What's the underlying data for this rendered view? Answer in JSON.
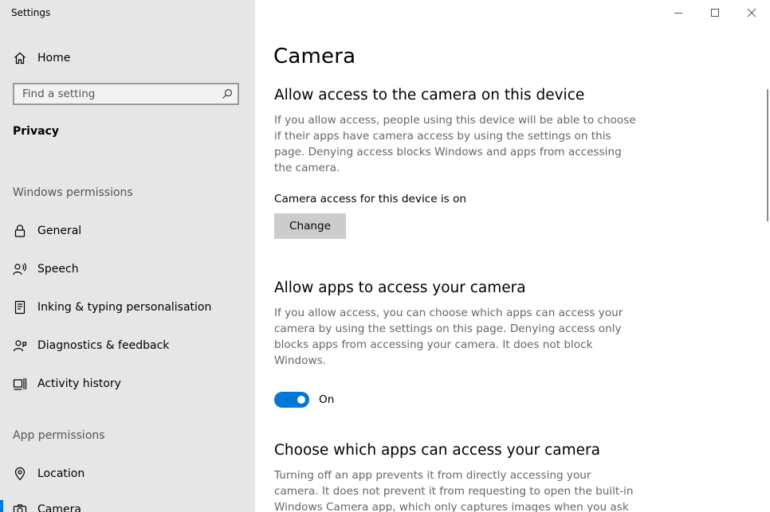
{
  "window": {
    "app_title": "Settings"
  },
  "sidebar": {
    "home": {
      "label": "Home",
      "icon": "home-icon"
    },
    "search": {
      "placeholder": "Find a setting",
      "icon": "search-icon"
    },
    "category": "Privacy",
    "groups": [
      {
        "label": "Windows permissions",
        "items": [
          {
            "label": "General",
            "icon": "lock-icon"
          },
          {
            "label": "Speech",
            "icon": "speech-icon"
          },
          {
            "label": "Inking & typing personalisation",
            "icon": "inking-icon"
          },
          {
            "label": "Diagnostics & feedback",
            "icon": "diagnostics-icon"
          },
          {
            "label": "Activity history",
            "icon": "activity-history-icon"
          }
        ]
      },
      {
        "label": "App permissions",
        "items": [
          {
            "label": "Location",
            "icon": "location-icon"
          },
          {
            "label": "Camera",
            "icon": "camera-icon",
            "selected": true
          }
        ]
      }
    ]
  },
  "main": {
    "title": "Camera",
    "sections": [
      {
        "heading": "Allow access to the camera on this device",
        "text": "If you allow access, people using this device will be able to choose if their apps have camera access by using the settings on this page. Denying access blocks Windows and apps from accessing the camera.",
        "status": "Camera access for this device is on",
        "button_label": "Change"
      },
      {
        "heading": "Allow apps to access your camera",
        "text": "If you allow access, you can choose which apps can access your camera by using the settings on this page. Denying access only blocks apps from accessing your camera. It does not block Windows.",
        "toggle_state": "On"
      },
      {
        "heading": "Choose which apps can access your camera",
        "text": "Turning off an app prevents it from directly accessing your camera. It does not prevent it from requesting to open the built-in Windows Camera app, which only captures images when you ask it to. To"
      }
    ]
  },
  "colors": {
    "sidebar_bg": "#e6e6e6",
    "accent": "#0078d7",
    "button_bg": "#cccccc",
    "secondary_text": "#666666"
  }
}
